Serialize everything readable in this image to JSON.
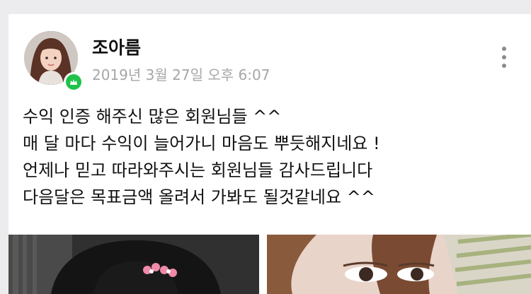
{
  "post": {
    "author": "조아름",
    "timestamp": "2019년 3월 27일 오후 6:07",
    "avatar_icon": "profile-avatar",
    "badge_icon": "verified-badge-icon",
    "badge_color": "#1fc24a",
    "more_icon": "more-vertical-icon",
    "body_lines": [
      "수익 인증 해주신 많은 회원님들 ^^",
      "매 달 마다 수익이 늘어가니 마음도 뿌듯해지네요 !",
      "언제나 믿고 따라와주시는 회원님들 감사드립니다",
      "다음달은 목표금액 올려서 가봐도 될것같네요 ^^"
    ],
    "photos": [
      "photo-1",
      "photo-2"
    ]
  }
}
